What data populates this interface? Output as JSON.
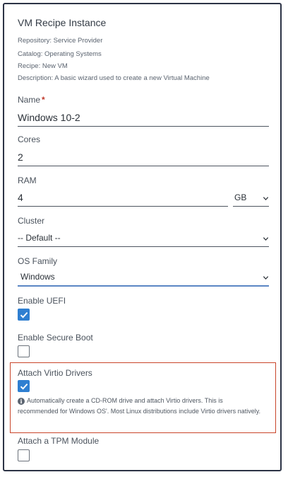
{
  "instance": {
    "title": "VM Recipe Instance",
    "repository": "Repository: Service Provider",
    "catalog": "Catalog: Operating Systems",
    "recipe": "Recipe: New VM",
    "description": "Description: A basic wizard used to create a new Virtual Machine"
  },
  "fields": {
    "name": {
      "label": "Name",
      "required_mark": "*",
      "value": "Windows 10-2"
    },
    "cores": {
      "label": "Cores",
      "value": "2"
    },
    "ram": {
      "label": "RAM",
      "value": "4",
      "unit": "GB"
    },
    "cluster": {
      "label": "Cluster",
      "value": "-- Default --"
    },
    "os_family": {
      "label": "OS Family",
      "value": "Windows"
    },
    "enable_uefi": {
      "label": "Enable UEFI",
      "checked": true
    },
    "enable_secure_boot": {
      "label": "Enable Secure Boot",
      "checked": false
    },
    "attach_virtio": {
      "label": "Attach Virtio Drivers",
      "checked": true,
      "info_icon": "info-icon",
      "help_text": "Automatically create a CD-ROM drive and attach Virtio drivers. This is recommended for Windows OS'. Most Linux distributions include Virtio drivers natively."
    },
    "attach_tpm": {
      "label": "Attach a TPM Module",
      "checked": false
    }
  },
  "colors": {
    "accent": "#2f7fd1",
    "highlight_border": "#c9452a",
    "required": "#c0392b",
    "focus_underline": "#5b86c4"
  }
}
